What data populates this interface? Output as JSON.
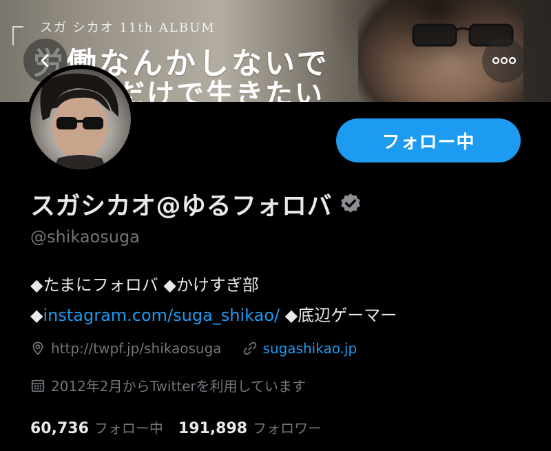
{
  "banner": {
    "subtitle": "スガ シカオ 11th ALBUM",
    "title_line1": "労働なんかしないで",
    "title_line2": "だけで生きたい"
  },
  "header": {
    "back_icon": "chevron-left-icon",
    "more_icon": "more-horizontal-icon"
  },
  "profile": {
    "follow_button_label": "フォロー中",
    "display_name": "スガシカオ@ゆるフォロバ",
    "verified_icon": "verified-badge-icon",
    "handle": "@shikaosuga",
    "bio": {
      "part1": "◆たまにフォロバ ◆かけすぎ部 ◆",
      "link1": "instagram.com/suga_shikao/",
      "part2": " ◆底辺ゲーマー"
    },
    "location": "http://twpf.jp/shikaosuga",
    "website": "sugashikao.jp",
    "joined": "2012年2月からTwitterを利用しています",
    "following_count": "60,736",
    "following_label": "フォロー中",
    "followers_count": "191,898",
    "followers_label": "フォロワー"
  },
  "colors": {
    "accent": "#1d9bf0",
    "background": "#000000",
    "text_primary": "#e7e9ea",
    "text_secondary": "#71767b"
  }
}
